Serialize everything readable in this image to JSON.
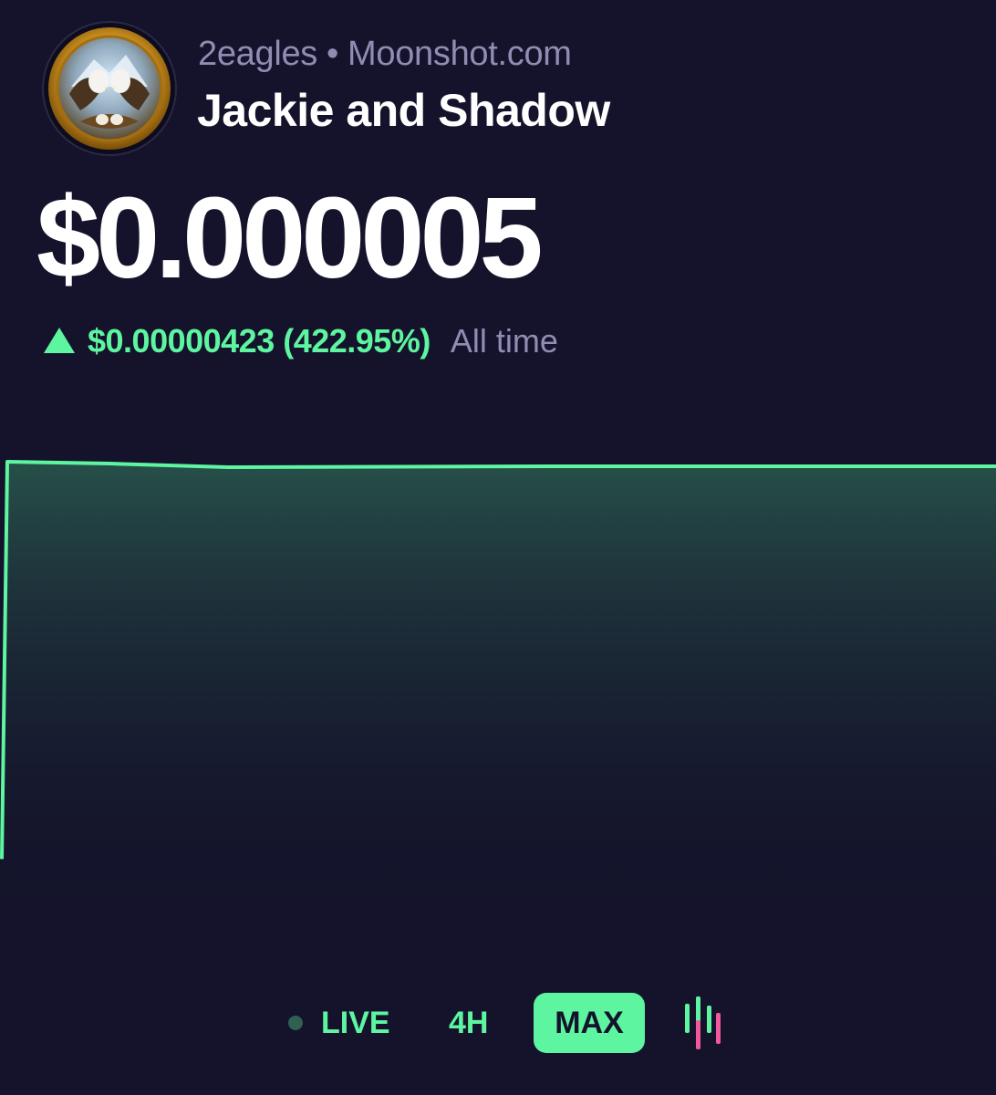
{
  "header": {
    "ticker": "2eagles",
    "separator": "•",
    "platform": "Moonshot.com",
    "token_name": "Jackie and Shadow",
    "avatar_icon": "eagles-coin-avatar"
  },
  "price": {
    "value": "$0.000005",
    "change": "$0.00000423 (422.95%)",
    "period": "All time",
    "direction_icon": "up-triangle-icon"
  },
  "colors": {
    "background": "#14132b",
    "accent": "#5ef5a0",
    "muted": "#8f8db2",
    "candle_red": "#f2589b"
  },
  "timeframes": {
    "live": "LIVE",
    "four_hour": "4H",
    "max": "MAX",
    "selected": "MAX",
    "chart_toggle_icon": "candlestick-chart-icon"
  },
  "chart_data": {
    "type": "area",
    "title": "",
    "xlabel": "",
    "ylabel": "",
    "grid": false,
    "series": [
      {
        "values": [
          7.7e-07,
          5e-06,
          5e-06,
          5e-06,
          5e-06,
          5e-06
        ]
      }
    ]
  }
}
